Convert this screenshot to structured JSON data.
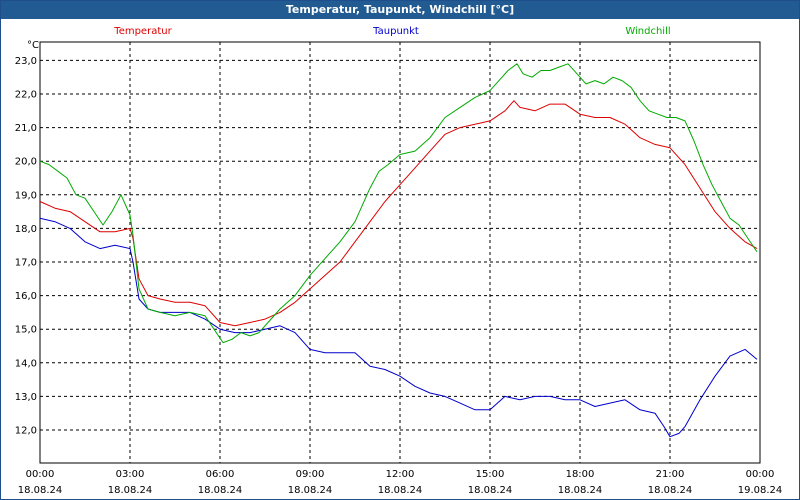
{
  "window": {
    "title": "Temperatur, Taupunkt, Windchill [°C]"
  },
  "chart_data": {
    "type": "line",
    "title": "Temperatur, Taupunkt, Windchill [°C]",
    "y_unit": "°C",
    "ylim": [
      11.5,
      23.5
    ],
    "y_ticks": [
      "12,0",
      "13,0",
      "14,0",
      "15,0",
      "16,0",
      "17,0",
      "18,0",
      "19,0",
      "20,0",
      "21,0",
      "22,0",
      "23,0"
    ],
    "y_tick_values": [
      12,
      13,
      14,
      15,
      16,
      17,
      18,
      19,
      20,
      21,
      22,
      23
    ],
    "x_range_hours": [
      0,
      24
    ],
    "x_ticks": [
      {
        "time": "00:00",
        "date": "18.08.24",
        "h": 0
      },
      {
        "time": "03:00",
        "date": "18.08.24",
        "h": 3
      },
      {
        "time": "06:00",
        "date": "18.08.24",
        "h": 6
      },
      {
        "time": "09:00",
        "date": "18.08.24",
        "h": 9
      },
      {
        "time": "12:00",
        "date": "18.08.24",
        "h": 12
      },
      {
        "time": "15:00",
        "date": "18.08.24",
        "h": 15
      },
      {
        "time": "18:00",
        "date": "18.08.24",
        "h": 18
      },
      {
        "time": "21:00",
        "date": "18.08.24",
        "h": 21
      },
      {
        "time": "00:00",
        "date": "19.08.24",
        "h": 24
      }
    ],
    "grid": true,
    "series": [
      {
        "name": "Temperatur",
        "color": "#dd0000",
        "x": [
          0,
          0.5,
          1,
          1.5,
          2,
          2.5,
          3,
          3.1,
          3.3,
          3.6,
          4,
          4.5,
          5,
          5.5,
          6,
          6.5,
          7,
          7.5,
          8,
          8.5,
          9,
          9.5,
          10,
          10.5,
          11,
          11.5,
          12,
          12.5,
          13,
          13.5,
          14,
          14.5,
          15,
          15.5,
          15.8,
          16,
          16.5,
          17,
          17.5,
          18,
          18.5,
          19,
          19.5,
          20,
          20.5,
          21,
          21.5,
          22,
          22.5,
          23,
          23.5,
          23.9
        ],
        "y": [
          18.8,
          18.6,
          18.5,
          18.2,
          17.9,
          17.9,
          18.0,
          17.7,
          16.5,
          16.0,
          15.9,
          15.8,
          15.8,
          15.7,
          15.2,
          15.1,
          15.2,
          15.3,
          15.5,
          15.8,
          16.2,
          16.6,
          17.0,
          17.6,
          18.2,
          18.8,
          19.3,
          19.8,
          20.3,
          20.8,
          21.0,
          21.1,
          21.2,
          21.5,
          21.8,
          21.6,
          21.5,
          21.7,
          21.7,
          21.4,
          21.3,
          21.3,
          21.1,
          20.7,
          20.5,
          20.4,
          19.9,
          19.2,
          18.5,
          18.0,
          17.6,
          17.4
        ]
      },
      {
        "name": "Taupunkt",
        "color": "#0000cc",
        "x": [
          0,
          0.5,
          1,
          1.5,
          2,
          2.5,
          3,
          3.1,
          3.3,
          3.6,
          4,
          4.5,
          5,
          5.5,
          6,
          6.5,
          7,
          7.5,
          8,
          8.5,
          9,
          9.5,
          10,
          10.5,
          11,
          11.5,
          12,
          12.5,
          13,
          13.5,
          14,
          14.5,
          15,
          15.5,
          16,
          16.5,
          17,
          17.5,
          18,
          18.5,
          19,
          19.5,
          20,
          20.5,
          20.8,
          21,
          21.3,
          21.5,
          22,
          22.5,
          23,
          23.5,
          23.9
        ],
        "y": [
          18.3,
          18.2,
          18.0,
          17.6,
          17.4,
          17.5,
          17.4,
          17.0,
          15.9,
          15.6,
          15.5,
          15.5,
          15.5,
          15.3,
          15.0,
          14.9,
          14.9,
          15.0,
          15.1,
          14.9,
          14.4,
          14.3,
          14.3,
          14.3,
          13.9,
          13.8,
          13.6,
          13.3,
          13.1,
          13.0,
          12.8,
          12.6,
          12.6,
          13.0,
          12.9,
          13.0,
          13.0,
          12.9,
          12.9,
          12.7,
          12.8,
          12.9,
          12.6,
          12.5,
          12.1,
          11.8,
          11.9,
          12.1,
          12.9,
          13.6,
          14.2,
          14.4,
          14.1
        ]
      },
      {
        "name": "Windchill",
        "color": "#00aa00",
        "x": [
          0,
          0.3,
          0.6,
          0.9,
          1.2,
          1.5,
          1.8,
          2.1,
          2.4,
          2.7,
          3.0,
          3.1,
          3.3,
          3.6,
          4,
          4.5,
          5,
          5.5,
          5.8,
          6.1,
          6.4,
          6.7,
          7,
          7.3,
          7.6,
          8,
          8.5,
          9,
          9.5,
          10,
          10.5,
          11,
          11.3,
          11.6,
          12,
          12.5,
          13,
          13.5,
          14,
          14.5,
          15,
          15.3,
          15.6,
          15.9,
          16.1,
          16.4,
          16.7,
          17,
          17.3,
          17.6,
          17.9,
          18.2,
          18.5,
          18.8,
          19.1,
          19.4,
          19.7,
          20,
          20.3,
          20.6,
          20.9,
          21.2,
          21.5,
          21.8,
          22.1,
          22.4,
          22.7,
          23,
          23.3,
          23.6,
          23.9
        ],
        "y": [
          20.0,
          19.9,
          19.7,
          19.5,
          19.0,
          18.9,
          18.5,
          18.1,
          18.5,
          19.0,
          18.4,
          17.8,
          16.2,
          15.6,
          15.5,
          15.4,
          15.5,
          15.4,
          15.0,
          14.6,
          14.7,
          14.9,
          14.8,
          14.9,
          15.2,
          15.6,
          16.0,
          16.6,
          17.1,
          17.6,
          18.2,
          19.2,
          19.7,
          19.9,
          20.2,
          20.3,
          20.7,
          21.3,
          21.6,
          21.9,
          22.1,
          22.4,
          22.7,
          22.9,
          22.6,
          22.5,
          22.7,
          22.7,
          22.8,
          22.9,
          22.6,
          22.3,
          22.4,
          22.3,
          22.5,
          22.4,
          22.2,
          21.8,
          21.5,
          21.4,
          21.3,
          21.3,
          21.2,
          20.6,
          19.9,
          19.3,
          18.8,
          18.3,
          18.1,
          17.7,
          17.3
        ]
      }
    ]
  }
}
